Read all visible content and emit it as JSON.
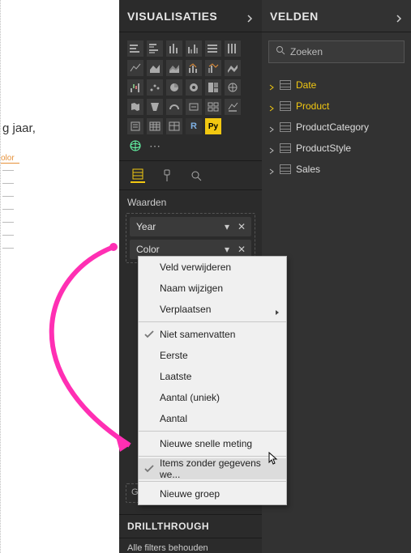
{
  "panels": {
    "visualizations_title": "VISUALISATIES",
    "fields_title": "VELDEN"
  },
  "search": {
    "placeholder": "Zoeken"
  },
  "field_tables": [
    {
      "name": "Date",
      "active": true
    },
    {
      "name": "Product",
      "active": true
    },
    {
      "name": "ProductCategory",
      "active": false
    },
    {
      "name": "ProductStyle",
      "active": false
    },
    {
      "name": "Sales",
      "active": false
    }
  ],
  "wells": {
    "values_label": "Waarden",
    "fields": [
      {
        "label": "Year"
      },
      {
        "label": "Color"
      }
    ],
    "placeholder": "Gegevensvelden hier naarto..."
  },
  "drillthrough": {
    "header": "DRILLTHROUGH",
    "sub": "Alle filters behouden"
  },
  "canvas": {
    "text": "g jaar,",
    "olor": "olor"
  },
  "context_menu": {
    "items": [
      {
        "label": "Veld verwijderen",
        "type": "item"
      },
      {
        "label": "Naam wijzigen",
        "type": "item"
      },
      {
        "label": "Verplaatsen",
        "type": "submenu"
      },
      {
        "type": "sep"
      },
      {
        "label": "Niet samenvatten",
        "type": "item",
        "checked": true
      },
      {
        "label": "Eerste",
        "type": "item"
      },
      {
        "label": "Laatste",
        "type": "item"
      },
      {
        "label": "Aantal (uniek)",
        "type": "item"
      },
      {
        "label": "Aantal",
        "type": "item"
      },
      {
        "type": "sep"
      },
      {
        "label": "Nieuwe snelle meting",
        "type": "item"
      },
      {
        "type": "sep"
      },
      {
        "label": "Items zonder gegevens we...",
        "type": "item",
        "checked": true,
        "highlight": true
      },
      {
        "type": "sep"
      },
      {
        "label": "Nieuwe groep",
        "type": "item"
      }
    ]
  },
  "gallery_py": "Py",
  "gallery_r": "R"
}
